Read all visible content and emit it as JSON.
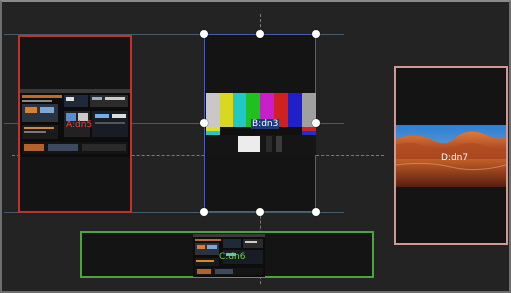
{
  "sources": [
    {
      "id": "a",
      "label": "A:dn5",
      "label_color": "#ff3a3a",
      "border_color": "#c0322c",
      "content": "desktop-screenshot"
    },
    {
      "id": "b",
      "label": "B:dn3",
      "label_color": "#ffffff",
      "border_color": "#4a5fa8",
      "content": "color-bars",
      "selected": true
    },
    {
      "id": "c",
      "label": "C:dn6",
      "label_color": "#6ad64a",
      "border_color": "#4aa63a",
      "content": "desktop-screenshot"
    },
    {
      "id": "d",
      "label": "D:dn7",
      "label_color": "#ffffff",
      "border_color": "#d09a93",
      "content": "canyon-photo"
    }
  ],
  "icons": [
    "resize-handle"
  ]
}
